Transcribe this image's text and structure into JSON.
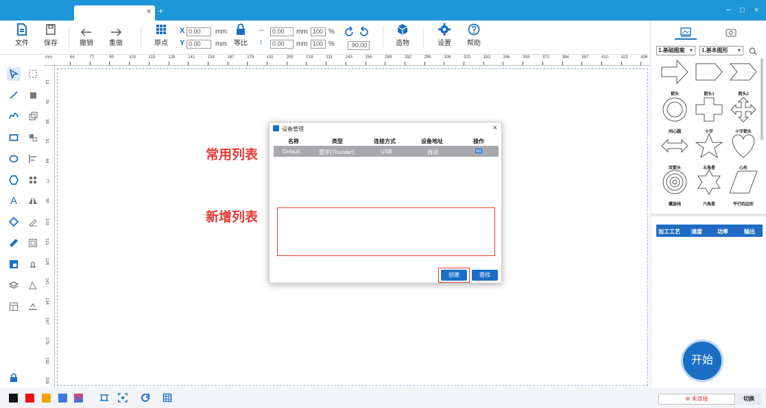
{
  "toolbar": {
    "file": "文件",
    "save": "保存",
    "undo": "撤销",
    "redo": "重做",
    "origin": "原点",
    "x_label": "X",
    "y_label": "Y",
    "x_value": "0.00",
    "y_value": "0.00",
    "mm": "mm",
    "equal": "等比",
    "w_value": "0.00",
    "h_value": "0.00",
    "w_pct": "100",
    "h_pct": "100",
    "pct": "%",
    "rotate_value": "90.00",
    "object": "造物",
    "settings": "设置",
    "help": "帮助"
  },
  "ruler": {
    "unit": "mm",
    "h_ticks": [
      "64",
      "77",
      "90",
      "103",
      "115",
      "128",
      "141",
      "154",
      "167",
      "179",
      "192",
      "205",
      "218",
      "231",
      "243",
      "256",
      "269",
      "282",
      "295",
      "308",
      "320",
      "333",
      "346",
      "359",
      "372",
      "384",
      "397",
      "410",
      "423",
      "436"
    ],
    "v_ticks": [
      "13",
      "26",
      "38",
      "51",
      "64",
      "77",
      "90",
      "103",
      "115",
      "128",
      "141",
      "154",
      "167",
      "179",
      "192",
      "205"
    ]
  },
  "annotations": {
    "common": "常用列表",
    "new": "新增列表"
  },
  "dialog": {
    "title": "设备管理",
    "close": "×",
    "headers": [
      "名称",
      "类型",
      "连接方式",
      "设备地址",
      "操作"
    ],
    "row": {
      "name": "Default",
      "type": "雷宇(Thunder)",
      "conn": "USB",
      "addr": "自动"
    },
    "create": "创建",
    "find": "查找"
  },
  "right": {
    "category": "1.基础图案",
    "subcategory": "1.基本图形",
    "shapes": [
      "箭头",
      "箭头1",
      "箭头2",
      "同心圆",
      "十字",
      "十字箭头",
      "双箭头",
      "五角星",
      "心形",
      "螺旋线",
      "六角星",
      "平行四边形"
    ],
    "table_headers": [
      "加工工艺",
      "速度",
      "功率",
      "输出"
    ],
    "start": "开始",
    "status": "未连接",
    "switch": "切换"
  },
  "colors": {
    "accent": "#1a6fc4",
    "titlebar": "#1e96d8",
    "red": "#e53935"
  },
  "window": {
    "minimize": "−",
    "maximize": "□",
    "close": "×"
  },
  "tab": {
    "close": "×",
    "add": "+"
  }
}
